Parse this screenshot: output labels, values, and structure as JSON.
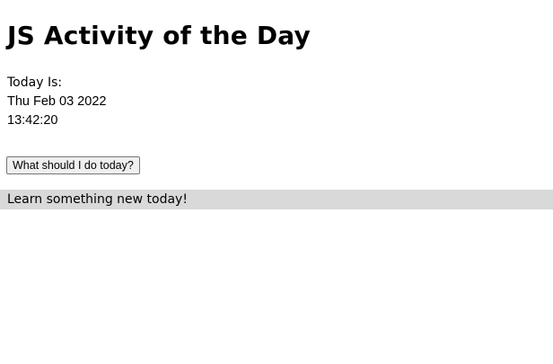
{
  "page": {
    "title": "JS Activity of the Day",
    "today": {
      "label": "Today Is:",
      "date": "Thu Feb 03 2022",
      "time": "13:42:20"
    },
    "button_label": "What should I do today?",
    "result": {
      "text": "Learn something new today!",
      "background": "#d9d9d9"
    }
  }
}
